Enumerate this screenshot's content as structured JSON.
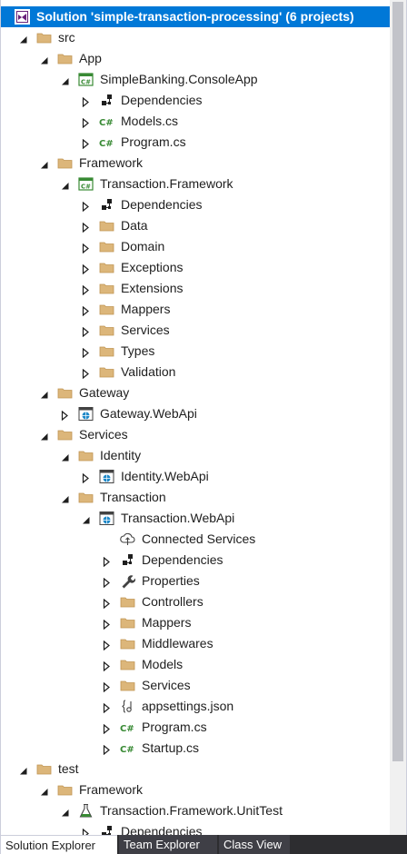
{
  "solution_explorer": {
    "rows": [
      {
        "label": "Solution 'simple-transaction-processing' (6 projects)",
        "icon": "solution-icon",
        "state": "none",
        "selected": true,
        "level": 0
      },
      {
        "label": "src",
        "icon": "folder-icon",
        "state": "expanded",
        "level": 0
      },
      {
        "label": "App",
        "icon": "folder-icon",
        "state": "expanded",
        "level": 1
      },
      {
        "label": "SimpleBanking.ConsoleApp",
        "icon": "csharp-project-icon",
        "state": "expanded",
        "level": 2
      },
      {
        "label": "Dependencies",
        "icon": "dependencies-icon",
        "state": "collapsed",
        "level": 3
      },
      {
        "label": "Models.cs",
        "icon": "csharp-file-icon",
        "state": "collapsed",
        "level": 3
      },
      {
        "label": "Program.cs",
        "icon": "csharp-file-icon",
        "state": "collapsed",
        "level": 3
      },
      {
        "label": "Framework",
        "icon": "folder-icon",
        "state": "expanded",
        "level": 1
      },
      {
        "label": "Transaction.Framework",
        "icon": "csharp-project-icon",
        "state": "expanded",
        "level": 2
      },
      {
        "label": "Dependencies",
        "icon": "dependencies-icon",
        "state": "collapsed",
        "level": 3
      },
      {
        "label": "Data",
        "icon": "folder-icon",
        "state": "collapsed",
        "level": 3
      },
      {
        "label": "Domain",
        "icon": "folder-icon",
        "state": "collapsed",
        "level": 3
      },
      {
        "label": "Exceptions",
        "icon": "folder-icon",
        "state": "collapsed",
        "level": 3
      },
      {
        "label": "Extensions",
        "icon": "folder-icon",
        "state": "collapsed",
        "level": 3
      },
      {
        "label": "Mappers",
        "icon": "folder-icon",
        "state": "collapsed",
        "level": 3
      },
      {
        "label": "Services",
        "icon": "folder-icon",
        "state": "collapsed",
        "level": 3
      },
      {
        "label": "Types",
        "icon": "folder-icon",
        "state": "collapsed",
        "level": 3
      },
      {
        "label": "Validation",
        "icon": "folder-icon",
        "state": "collapsed",
        "level": 3
      },
      {
        "label": "Gateway",
        "icon": "folder-icon",
        "state": "expanded",
        "level": 1
      },
      {
        "label": "Gateway.WebApi",
        "icon": "web-project-icon",
        "state": "collapsed",
        "level": 2
      },
      {
        "label": "Services",
        "icon": "folder-icon",
        "state": "expanded",
        "level": 1
      },
      {
        "label": "Identity",
        "icon": "folder-icon",
        "state": "expanded",
        "level": 2
      },
      {
        "label": "Identity.WebApi",
        "icon": "web-project-icon",
        "state": "collapsed",
        "level": 3
      },
      {
        "label": "Transaction",
        "icon": "folder-icon",
        "state": "expanded",
        "level": 2
      },
      {
        "label": "Transaction.WebApi",
        "icon": "web-project-icon",
        "state": "expanded",
        "level": 3
      },
      {
        "label": "Connected Services",
        "icon": "connected-services-icon",
        "state": "none",
        "level": 4
      },
      {
        "label": "Dependencies",
        "icon": "dependencies-icon",
        "state": "collapsed",
        "level": 4
      },
      {
        "label": "Properties",
        "icon": "wrench-icon",
        "state": "collapsed",
        "level": 4
      },
      {
        "label": "Controllers",
        "icon": "folder-icon",
        "state": "collapsed",
        "level": 4
      },
      {
        "label": "Mappers",
        "icon": "folder-icon",
        "state": "collapsed",
        "level": 4
      },
      {
        "label": "Middlewares",
        "icon": "folder-icon",
        "state": "collapsed",
        "level": 4
      },
      {
        "label": "Models",
        "icon": "folder-icon",
        "state": "collapsed",
        "level": 4
      },
      {
        "label": "Services",
        "icon": "folder-icon",
        "state": "collapsed",
        "level": 4
      },
      {
        "label": "appsettings.json",
        "icon": "json-file-icon",
        "state": "collapsed",
        "level": 4
      },
      {
        "label": "Program.cs",
        "icon": "csharp-file-icon",
        "state": "collapsed",
        "level": 4
      },
      {
        "label": "Startup.cs",
        "icon": "csharp-file-icon",
        "state": "collapsed",
        "level": 4
      },
      {
        "label": "test",
        "icon": "folder-icon",
        "state": "expanded",
        "level": 0
      },
      {
        "label": "Framework",
        "icon": "folder-icon",
        "state": "expanded",
        "level": 1
      },
      {
        "label": "Transaction.Framework.UnitTest",
        "icon": "test-project-icon",
        "state": "expanded",
        "level": 2
      },
      {
        "label": "Dependencies",
        "icon": "dependencies-icon",
        "state": "collapsed",
        "level": 3
      }
    ]
  },
  "tabs": [
    {
      "label": "Solution Explorer",
      "active": true
    },
    {
      "label": "Team Explorer",
      "active": false
    },
    {
      "label": "Class View",
      "active": false
    }
  ],
  "colors": {
    "selection": "#0078d7",
    "folder": "#dcb67a",
    "csharp": "#388a34",
    "web": "#1e88c8",
    "tab_bar": "#2d2d30"
  }
}
